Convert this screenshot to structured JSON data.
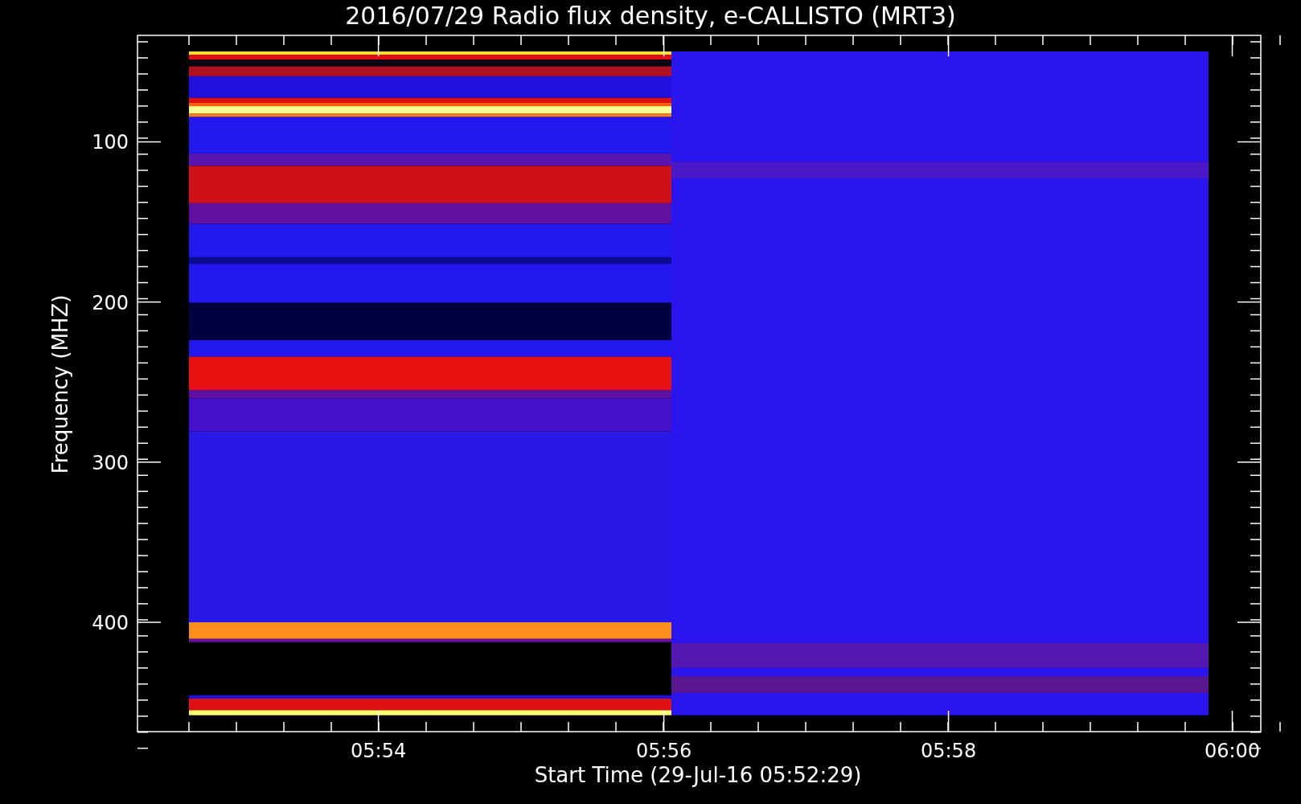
{
  "title": "2016/07/29  Radio flux density, e-CALLISTO (MRT3)",
  "ylabel": "Frequency (MHZ)",
  "xlabel": "Start Time (29-Jul-16 05:52:29)",
  "yticks": [
    {
      "label": "100"
    },
    {
      "label": "200"
    },
    {
      "label": "300"
    },
    {
      "label": "400"
    }
  ],
  "xticks": [
    {
      "label": "05:54"
    },
    {
      "label": "05:56"
    },
    {
      "label": "05:58"
    },
    {
      "label": "06:00"
    }
  ]
}
